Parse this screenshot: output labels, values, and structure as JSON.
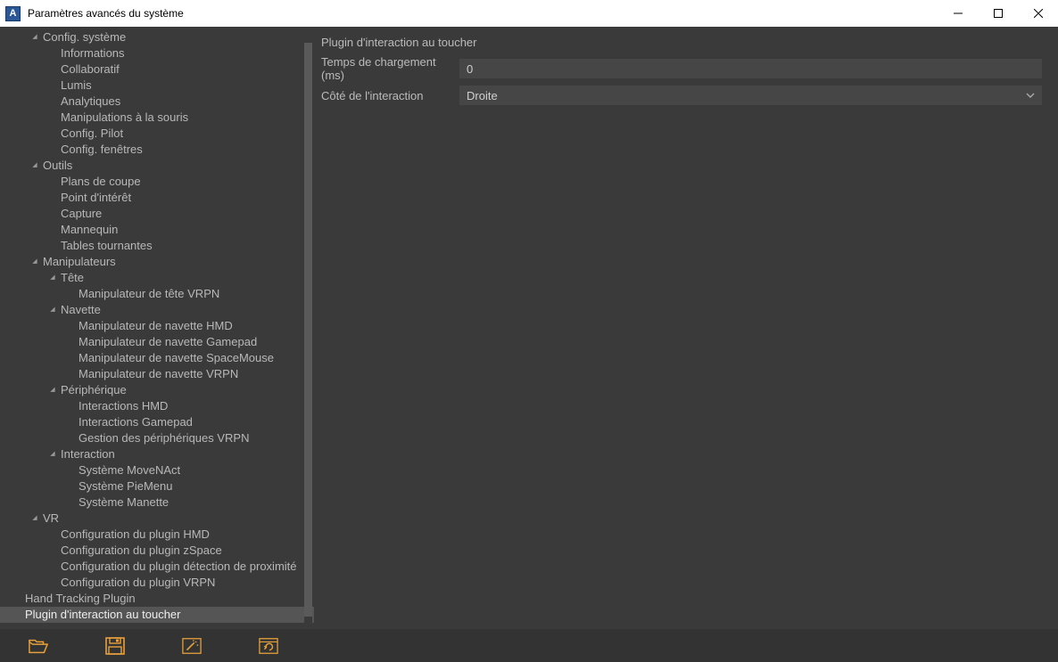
{
  "window": {
    "title": "Paramètres avancés du système"
  },
  "accent": "#e6a03c",
  "tree": [
    {
      "level": 2,
      "bullet": true,
      "label": "Config. système"
    },
    {
      "level": 3,
      "label": "Informations"
    },
    {
      "level": 3,
      "label": "Collaboratif"
    },
    {
      "level": 3,
      "label": "Lumis"
    },
    {
      "level": 3,
      "label": "Analytiques"
    },
    {
      "level": 3,
      "label": "Manipulations à la souris"
    },
    {
      "level": 3,
      "label": "Config. Pilot"
    },
    {
      "level": 3,
      "label": "Config. fenêtres"
    },
    {
      "level": 2,
      "bullet": true,
      "label": "Outils"
    },
    {
      "level": 3,
      "label": "Plans de coupe"
    },
    {
      "level": 3,
      "label": "Point d'intérêt"
    },
    {
      "level": 3,
      "label": "Capture"
    },
    {
      "level": 3,
      "label": "Mannequin"
    },
    {
      "level": 3,
      "label": "Tables tournantes"
    },
    {
      "level": 2,
      "bullet": true,
      "label": "Manipulateurs"
    },
    {
      "level": 3,
      "bullet": true,
      "label": "Tête"
    },
    {
      "level": 4,
      "label": "Manipulateur de tête VRPN"
    },
    {
      "level": 3,
      "bullet": true,
      "label": "Navette"
    },
    {
      "level": 4,
      "label": "Manipulateur de navette HMD"
    },
    {
      "level": 4,
      "label": "Manipulateur de navette Gamepad"
    },
    {
      "level": 4,
      "label": "Manipulateur de navette SpaceMouse"
    },
    {
      "level": 4,
      "label": "Manipulateur de navette VRPN"
    },
    {
      "level": 3,
      "bullet": true,
      "label": "Périphérique"
    },
    {
      "level": 4,
      "label": "Interactions HMD"
    },
    {
      "level": 4,
      "label": "Interactions Gamepad"
    },
    {
      "level": 4,
      "label": "Gestion des périphériques VRPN"
    },
    {
      "level": 3,
      "bullet": true,
      "label": "Interaction"
    },
    {
      "level": 4,
      "label": "Système MoveNAct"
    },
    {
      "level": 4,
      "label": "Système PieMenu"
    },
    {
      "level": 4,
      "label": "Système Manette"
    },
    {
      "level": 2,
      "bullet": true,
      "label": "VR"
    },
    {
      "level": 3,
      "label": "Configuration du plugin HMD"
    },
    {
      "level": 3,
      "label": "Configuration du plugin zSpace"
    },
    {
      "level": 3,
      "label": "Configuration du plugin détection de proximité"
    },
    {
      "level": 3,
      "label": "Configuration du plugin VRPN"
    },
    {
      "level": 1,
      "label": "Hand Tracking Plugin"
    },
    {
      "level": 1,
      "label": "Plugin d'interaction au toucher",
      "selected": true
    }
  ],
  "panel": {
    "header": "Plugin d'interaction au toucher",
    "loadingLabel": "Temps de chargement (ms)",
    "loadingValue": "0",
    "sideLabel": "Côté de l'interaction",
    "sideValue": "Droite"
  },
  "toolbar": {
    "open": "open-icon",
    "save": "save-icon",
    "wand": "wand-icon",
    "reset": "reset-icon"
  }
}
